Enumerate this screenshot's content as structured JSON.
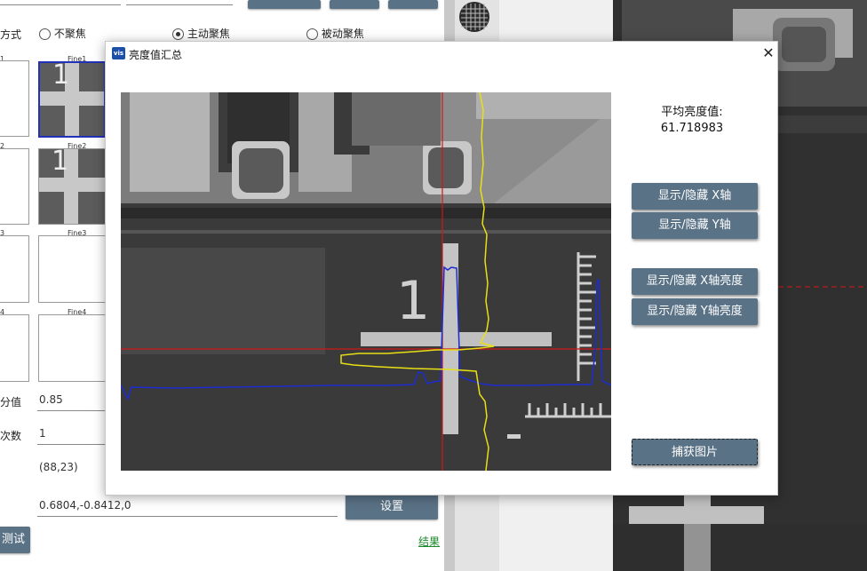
{
  "background": {
    "focus_mode_label": "方式",
    "focus_options": [
      "不聚焦",
      "主动聚焦",
      "被动聚焦"
    ],
    "focus_selected": "主动聚焦",
    "thumbnails": [
      {
        "left_caption": "1",
        "right_caption": "Fine1"
      },
      {
        "left_caption": "2",
        "right_caption": "Fine2"
      },
      {
        "left_caption": "3",
        "right_caption": "Fine3"
      },
      {
        "left_caption": "4",
        "right_caption": "Fine4"
      }
    ],
    "threshold_label": "分值",
    "threshold_value": "0.85",
    "count_label": "次数",
    "count_value": "1",
    "coord_text": "(88,23)",
    "offset_value": "0.6804,-0.8412,0",
    "set_button": "设置",
    "test_button": "测试",
    "result_link": "结果",
    "thumb_digit": "1"
  },
  "dialog": {
    "title": "亮度值汇总",
    "icon_text": "vis",
    "close": "✕",
    "avg_label": "平均亮度值:",
    "avg_value": "61.718983",
    "buttons": {
      "toggle_x": "显示/隐藏 X轴",
      "toggle_y": "显示/隐藏 Y轴",
      "toggle_x_brightness": "显示/隐藏 X轴亮度",
      "toggle_y_brightness": "显示/隐藏 Y轴亮度",
      "capture": "捕获图片"
    },
    "image_digit": "1",
    "colors": {
      "crosshair": "#d01818",
      "x_profile": "#1c2cd0",
      "y_profile": "#e8e014"
    }
  }
}
